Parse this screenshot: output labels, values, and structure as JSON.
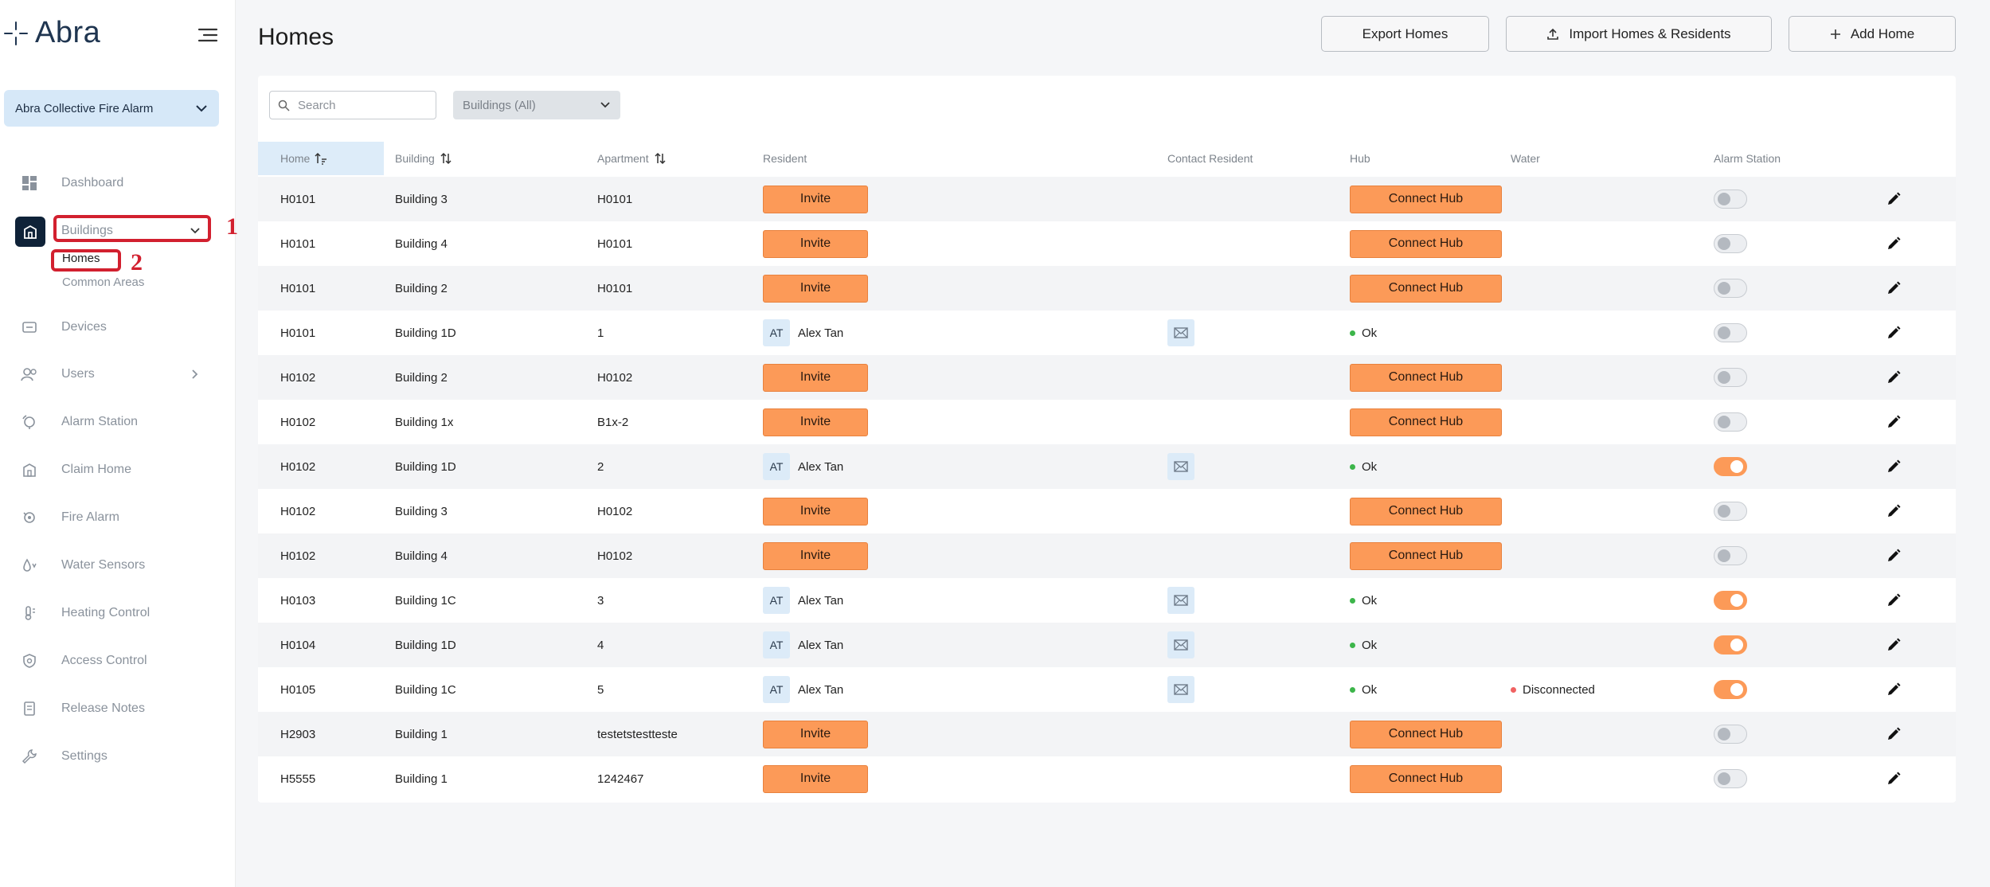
{
  "app": {
    "logo_text": "Abra"
  },
  "sidebar": {
    "org_select": "Abra Collective Fire Alarm",
    "items": [
      {
        "key": "dashboard",
        "label": "Dashboard",
        "icon": "dashboard-icon"
      },
      {
        "key": "buildings",
        "label": "Buildings",
        "icon": "building-icon"
      },
      {
        "key": "devices",
        "label": "Devices",
        "icon": "devices-icon"
      },
      {
        "key": "users",
        "label": "Users",
        "icon": "users-icon"
      },
      {
        "key": "alarm-station",
        "label": "Alarm Station",
        "icon": "alarm-icon"
      },
      {
        "key": "claim-home",
        "label": "Claim Home",
        "icon": "home-icon"
      },
      {
        "key": "fire-alarm",
        "label": "Fire Alarm",
        "icon": "fire-icon"
      },
      {
        "key": "water-sensors",
        "label": "Water Sensors",
        "icon": "water-icon"
      },
      {
        "key": "heating-control",
        "label": "Heating Control",
        "icon": "thermometer-icon"
      },
      {
        "key": "access-control",
        "label": "Access Control",
        "icon": "shield-icon"
      },
      {
        "key": "release-notes",
        "label": "Release Notes",
        "icon": "notes-icon"
      },
      {
        "key": "settings",
        "label": "Settings",
        "icon": "wrench-icon"
      }
    ],
    "sub_items": [
      {
        "label": "Homes"
      },
      {
        "label": "Common Areas"
      }
    ],
    "annotations": [
      "1",
      "2"
    ]
  },
  "header": {
    "title": "Homes",
    "export_label": "Export Homes",
    "import_label": "Import Homes & Residents",
    "add_label": "Add Home"
  },
  "filters": {
    "search_placeholder": "Search",
    "buildings_filter": "Buildings (All)"
  },
  "table": {
    "columns": {
      "home": "Home",
      "building": "Building",
      "apartment": "Apartment",
      "resident": "Resident",
      "contact": "Contact Resident",
      "hub": "Hub",
      "water": "Water",
      "alarm": "Alarm Station"
    },
    "invite_label": "Invite",
    "connect_label": "Connect Hub",
    "rows": [
      {
        "home": "H0101",
        "building": "Building 3",
        "apartment": "H0101",
        "resident": null,
        "hub": null,
        "water": null,
        "alarm": false
      },
      {
        "home": "H0101",
        "building": "Building 4",
        "apartment": "H0101",
        "resident": null,
        "hub": null,
        "water": null,
        "alarm": false
      },
      {
        "home": "H0101",
        "building": "Building 2",
        "apartment": "H0101",
        "resident": null,
        "hub": null,
        "water": null,
        "alarm": false
      },
      {
        "home": "H0101",
        "building": "Building 1D",
        "apartment": "1",
        "resident": {
          "initials": "AT",
          "name": "Alex Tan"
        },
        "hub": "Ok",
        "water": null,
        "alarm": false
      },
      {
        "home": "H0102",
        "building": "Building 2",
        "apartment": "H0102",
        "resident": null,
        "hub": null,
        "water": null,
        "alarm": false
      },
      {
        "home": "H0102",
        "building": "Building 1x",
        "apartment": "B1x-2",
        "resident": null,
        "hub": null,
        "water": null,
        "alarm": false
      },
      {
        "home": "H0102",
        "building": "Building 1D",
        "apartment": "2",
        "resident": {
          "initials": "AT",
          "name": "Alex Tan"
        },
        "hub": "Ok",
        "water": null,
        "alarm": true
      },
      {
        "home": "H0102",
        "building": "Building 3",
        "apartment": "H0102",
        "resident": null,
        "hub": null,
        "water": null,
        "alarm": false
      },
      {
        "home": "H0102",
        "building": "Building 4",
        "apartment": "H0102",
        "resident": null,
        "hub": null,
        "water": null,
        "alarm": false
      },
      {
        "home": "H0103",
        "building": "Building 1C",
        "apartment": "3",
        "resident": {
          "initials": "AT",
          "name": "Alex Tan"
        },
        "hub": "Ok",
        "water": null,
        "alarm": true
      },
      {
        "home": "H0104",
        "building": "Building 1D",
        "apartment": "4",
        "resident": {
          "initials": "AT",
          "name": "Alex Tan"
        },
        "hub": "Ok",
        "water": null,
        "alarm": true
      },
      {
        "home": "H0105",
        "building": "Building 1C",
        "apartment": "5",
        "resident": {
          "initials": "AT",
          "name": "Alex Tan"
        },
        "hub": "Ok",
        "water": "Disconnected",
        "alarm": true
      },
      {
        "home": "H2903",
        "building": "Building 1",
        "apartment": "testetstestteste",
        "resident": null,
        "hub": null,
        "water": null,
        "alarm": false
      },
      {
        "home": "H5555",
        "building": "Building 1",
        "apartment": "1242467",
        "resident": null,
        "hub": null,
        "water": null,
        "alarm": false
      }
    ]
  },
  "colors": {
    "accent_orange": "#fc9a58",
    "ok_green": "#3cb54a",
    "error_red": "#f06262",
    "annotation_red": "#d2202f",
    "active_nav": "#0f2238"
  }
}
